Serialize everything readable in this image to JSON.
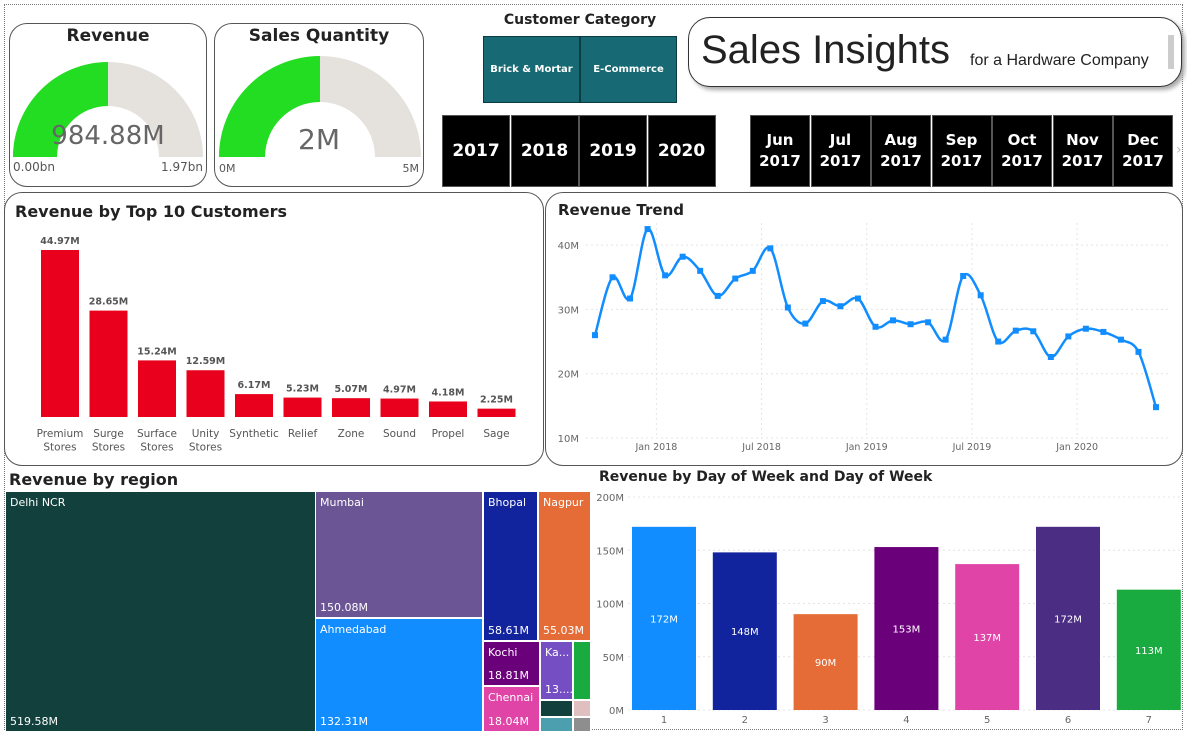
{
  "gauges": {
    "revenue": {
      "title": "Revenue",
      "value_label": "984.88M",
      "min_label": "0.00bn",
      "max_label": "1.97bn",
      "fraction": 0.5
    },
    "quantity": {
      "title": "Sales Quantity",
      "value_label": "2M",
      "min_label": "0M",
      "max_label": "5M",
      "fraction": 0.4
    }
  },
  "customer_category": {
    "title": "Customer Category",
    "options": [
      "Brick & Mortar",
      "E-Commerce"
    ]
  },
  "header": {
    "title": "Sales Insights",
    "subtitle": "for a Hardware Company"
  },
  "years": [
    "2017",
    "2018",
    "2019",
    "2020"
  ],
  "months": [
    {
      "m": "Jun",
      "y": "2017"
    },
    {
      "m": "Jul",
      "y": "2017"
    },
    {
      "m": "Aug",
      "y": "2017"
    },
    {
      "m": "Sep",
      "y": "2017"
    },
    {
      "m": "Oct",
      "y": "2017"
    },
    {
      "m": "Nov",
      "y": "2017"
    },
    {
      "m": "Dec",
      "y": "2017"
    }
  ],
  "colors": {
    "red": "#e8001c",
    "green": "#22dd22",
    "gray": "#e5e1dc",
    "teal": "#176a74",
    "line": "#118dff"
  },
  "top_customers": {
    "title": "Revenue by Top 10 Customers",
    "chart_data": {
      "type": "bar",
      "categories": [
        [
          "Premium",
          "Stores"
        ],
        [
          "Surge",
          "Stores"
        ],
        [
          "Surface",
          "Stores"
        ],
        [
          "Unity",
          "Stores"
        ],
        [
          "Synthetic"
        ],
        [
          "Relief"
        ],
        [
          "Zone"
        ],
        [
          "Sound"
        ],
        [
          "Propel"
        ],
        [
          "Sage"
        ]
      ],
      "values": [
        44.97,
        28.65,
        15.24,
        12.59,
        6.17,
        5.23,
        5.07,
        4.97,
        4.18,
        2.25
      ],
      "labels": [
        "44.97M",
        "28.65M",
        "15.24M",
        "12.59M",
        "6.17M",
        "5.23M",
        "5.07M",
        "4.97M",
        "4.18M",
        "2.25M"
      ]
    }
  },
  "revenue_trend": {
    "title": "Revenue Trend",
    "chart_data": {
      "type": "line",
      "ylim": [
        10,
        45
      ],
      "yticks": [
        10,
        20,
        30,
        40
      ],
      "ytick_labels": [
        "10M",
        "20M",
        "30M",
        "40M"
      ],
      "xtick_labels": [
        "Jan 2018",
        "Jul 2018",
        "Jan 2019",
        "Jul 2019",
        "Jan 2020"
      ],
      "xtick_index": [
        3.5,
        9.5,
        15.5,
        21.5,
        27.5
      ],
      "values": [
        26,
        35,
        31.7,
        42.5,
        35.3,
        38.2,
        36,
        32.1,
        34.8,
        36,
        39.5,
        30.3,
        27.8,
        31.3,
        30.5,
        31.7,
        27.3,
        28.3,
        27.7,
        28,
        25.3,
        35.2,
        32.2,
        25,
        26.7,
        26.6,
        22.6,
        25.8,
        27,
        26.5,
        25.3,
        23.4,
        14.8
      ]
    }
  },
  "region": {
    "title": "Revenue by region",
    "chart_data": {
      "type": "treemap",
      "items": [
        {
          "name": "Delhi NCR",
          "value": "519.58M",
          "color": "#12403c"
        },
        {
          "name": "Mumbai",
          "value": "150.08M",
          "color": "#6b5594"
        },
        {
          "name": "Ahmedabad",
          "value": "132.31M",
          "color": "#118dff"
        },
        {
          "name": "Bhopal",
          "value": "58.61M",
          "color": "#12239e"
        },
        {
          "name": "Nagpur",
          "value": "55.03M",
          "color": "#e66c37"
        },
        {
          "name": "Kochi",
          "value": "18.81M",
          "color": "#6b007b"
        },
        {
          "name": "Chennai",
          "value": "18.04M",
          "color": "#e044a7"
        },
        {
          "name": "Ka...",
          "value": "13....",
          "color": "#744ec2"
        }
      ]
    }
  },
  "day_of_week": {
    "title": "Revenue by Day of Week and Day of Week",
    "chart_data": {
      "type": "bar",
      "categories": [
        "1",
        "2",
        "3",
        "4",
        "5",
        "6",
        "7"
      ],
      "values": [
        172,
        148,
        90,
        153,
        137,
        172,
        113
      ],
      "labels": [
        "172M",
        "148M",
        "90M",
        "153M",
        "137M",
        "172M",
        "113M"
      ],
      "colors": [
        "#118dff",
        "#12239e",
        "#e66c37",
        "#6b007b",
        "#e044a7",
        "#4b2e83",
        "#1aab40"
      ],
      "ylim": [
        0,
        200
      ],
      "ytick_labels": [
        "0M",
        "50M",
        "100M",
        "150M",
        "200M"
      ]
    }
  }
}
